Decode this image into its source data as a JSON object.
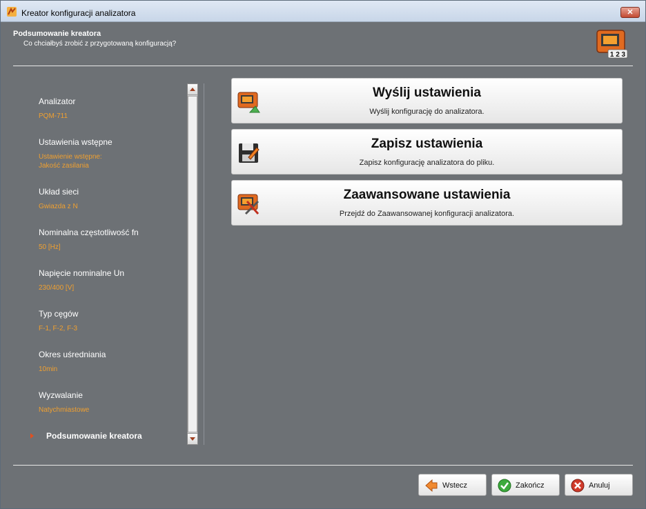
{
  "window": {
    "title": "Kreator konfiguracji analizatora",
    "close_label": "✕"
  },
  "header": {
    "title": "Podsumowanie kreatora",
    "subtitle": "Co chciałbyś zrobić z przygotowaną konfiguracją?",
    "icon_caption": "1 2 3"
  },
  "steps": [
    {
      "label": "Analizator",
      "value": "PQM-711"
    },
    {
      "label": "Ustawienia wstępne",
      "value": "Ustawienie wstępne:",
      "value2": "Jakość zasilania"
    },
    {
      "label": "Układ sieci",
      "value": "Gwiazda z N"
    },
    {
      "label": "Nominalna częstotliwość fn",
      "value": "50 [Hz]"
    },
    {
      "label": "Napięcie nominalne Un",
      "value": "230/400 [V]"
    },
    {
      "label": "Typ cęgów",
      "value": "F-1, F-2, F-3"
    },
    {
      "label": "Okres uśredniania",
      "value": "10min"
    },
    {
      "label": "Wyzwalanie",
      "value": "Natychmiastowe"
    }
  ],
  "current_step": "Podsumowanie kreatora",
  "actions": [
    {
      "title": "Wyślij ustawienia",
      "description": "Wyślij konfigurację do analizatora.",
      "icon": "send-device-icon"
    },
    {
      "title": "Zapisz ustawienia",
      "description": "Zapisz konfigurację analizatora do pliku.",
      "icon": "save-floppy-icon"
    },
    {
      "title": "Zaawansowane ustawienia",
      "description": "Przejdź do Zaawansowanej konfiguracji analizatora.",
      "icon": "advanced-tools-icon"
    }
  ],
  "footer": {
    "back_label": "Wstecz",
    "finish_label": "Zakończ",
    "cancel_label": "Anuluj"
  },
  "colors": {
    "background": "#6d7175",
    "step_value": "#f0a030",
    "accent_orange": "#e07020"
  }
}
